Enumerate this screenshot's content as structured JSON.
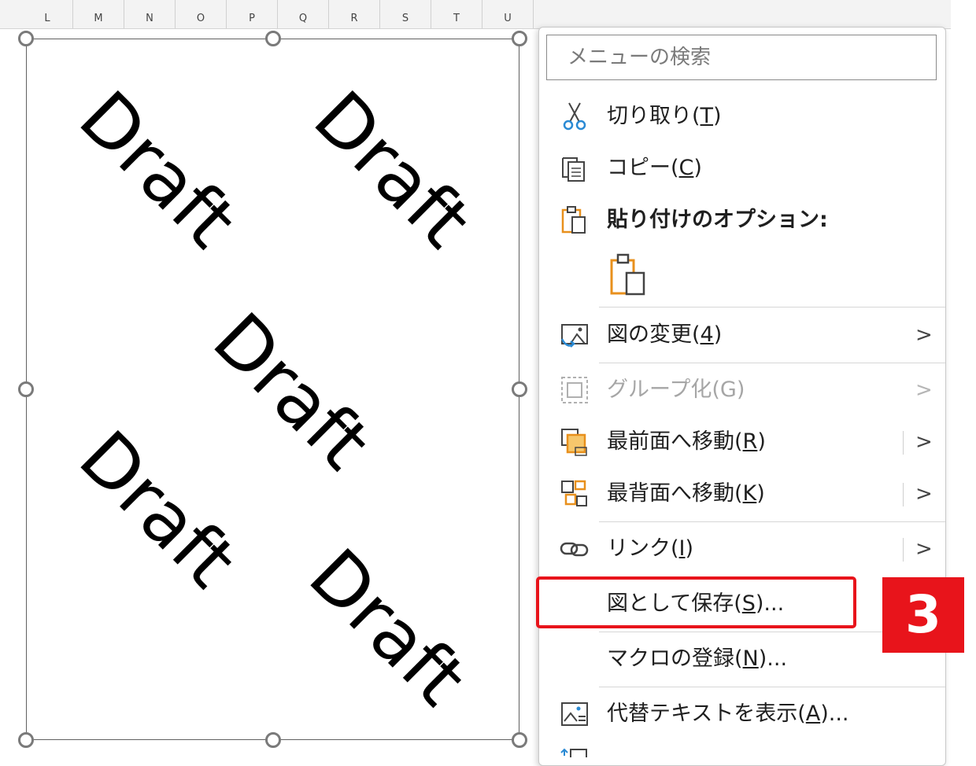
{
  "columns": [
    "L",
    "M",
    "N",
    "O",
    "P",
    "Q",
    "R",
    "S",
    "T",
    "U"
  ],
  "picture": {
    "watermarks": [
      "Draft",
      "Draft",
      "Draft",
      "Draft",
      "Draft"
    ]
  },
  "menu": {
    "search_placeholder": "メニューの検索",
    "cut": {
      "label": "切り取り(",
      "key": "T",
      "tail": ")"
    },
    "copy": {
      "label": "コピー(",
      "key": "C",
      "tail": ")"
    },
    "paste_options": {
      "label": "貼り付けのオプション:"
    },
    "change_picture": {
      "label": "図の変更(",
      "key": "4",
      "tail": ")"
    },
    "group": {
      "label": "グループ化(G)"
    },
    "bring_front": {
      "label": "最前面へ移動(",
      "key": "R",
      "tail": ")"
    },
    "send_back": {
      "label": "最背面へ移動(",
      "key": "K",
      "tail": ")"
    },
    "link": {
      "label": "リンク(",
      "key": "I",
      "tail": ")"
    },
    "save_as_picture": {
      "label": "図として保存(",
      "key": "S",
      "tail": ")..."
    },
    "assign_macro": {
      "label": "マクロの登録(",
      "key": "N",
      "tail": ")..."
    },
    "alt_text": {
      "label": "代替テキストを表示(",
      "key": "A",
      "tail": ")..."
    }
  },
  "step_badge": "3",
  "colors": {
    "accent_red": "#e8141b",
    "office_orange": "#e8901d",
    "office_blue": "#2a8ad4"
  }
}
